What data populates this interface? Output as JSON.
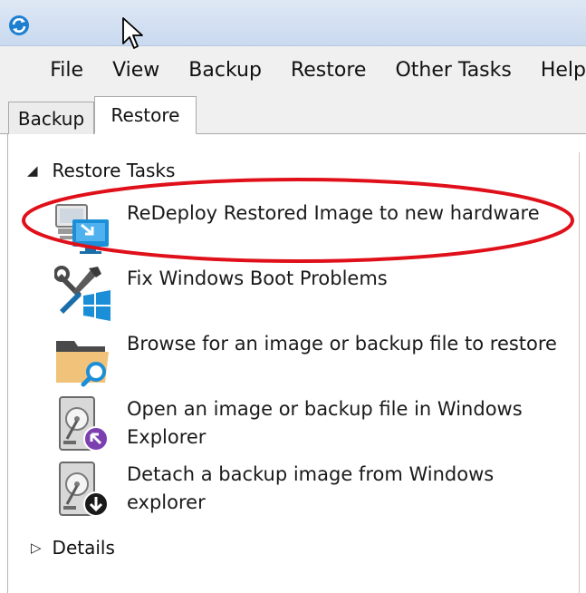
{
  "menu": {
    "items": [
      "File",
      "View",
      "Backup",
      "Restore",
      "Other Tasks",
      "Help"
    ]
  },
  "tabs": {
    "backup": "Backup",
    "restore": "Restore"
  },
  "restore_tasks": {
    "header": "Restore Tasks",
    "items": [
      {
        "label": "ReDeploy Restored Image to new hardware",
        "icon": "redeploy-icon"
      },
      {
        "label": "Fix Windows Boot Problems",
        "icon": "fix-boot-icon"
      },
      {
        "label": "Browse for an image or backup file to restore",
        "icon": "browse-folder-icon"
      },
      {
        "label": "Open an image or backup file in Windows Explorer",
        "icon": "open-disk-icon"
      },
      {
        "label": "Detach a backup image from Windows explorer",
        "icon": "detach-disk-icon"
      }
    ]
  },
  "details": {
    "header": "Details"
  },
  "colors": {
    "highlight": "#e0101a",
    "accent_blue": "#1a8fd8"
  }
}
